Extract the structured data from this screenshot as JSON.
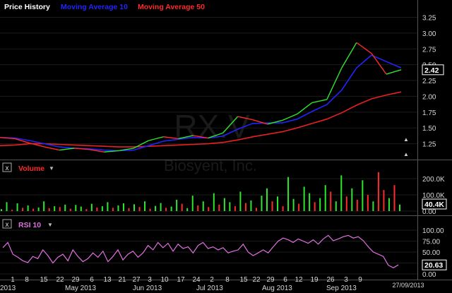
{
  "chart_data": [
    {
      "panel": "price",
      "type": "line",
      "legend": [
        {
          "name": "Price History",
          "color": "#ffffff"
        },
        {
          "name": "Moving Average 10",
          "color": "#2323ff"
        },
        {
          "name": "Moving Average 50",
          "color": "#ff2a2a"
        }
      ],
      "watermark": {
        "ticker": "RX.V",
        "company": "Biosyent, Inc."
      },
      "ylim": [
        1.0,
        3.3
      ],
      "yticks": [
        "3.25",
        "3.00",
        "2.75",
        "2.50",
        "2.25",
        "2.00",
        "1.75",
        "1.50",
        "1.25"
      ],
      "last_value": "2.42",
      "x_weeks": [
        "2013-03-28",
        "2013-04-01",
        "2013-04-08",
        "2013-04-15",
        "2013-04-22",
        "2013-04-29",
        "2013-05-06",
        "2013-05-13",
        "2013-05-20",
        "2013-05-27",
        "2013-06-03",
        "2013-06-10",
        "2013-06-17",
        "2013-06-24",
        "2013-07-01",
        "2013-07-08",
        "2013-07-15",
        "2013-07-22",
        "2013-07-29",
        "2013-08-06",
        "2013-08-12",
        "2013-08-19",
        "2013-08-26",
        "2013-09-03",
        "2013-09-09",
        "2013-09-16",
        "2013-09-23",
        "2013-09-27"
      ],
      "series": [
        {
          "name": "Price History",
          "color_up": "#2ee62e",
          "color_down": "#ff2a2a",
          "values": [
            1.35,
            1.33,
            1.26,
            1.2,
            1.15,
            1.18,
            1.16,
            1.12,
            1.14,
            1.18,
            1.3,
            1.36,
            1.33,
            1.38,
            1.34,
            1.42,
            1.68,
            1.63,
            1.56,
            1.62,
            1.72,
            1.9,
            1.95,
            2.45,
            2.85,
            2.68,
            2.35,
            2.42
          ]
        },
        {
          "name": "Moving Average 10",
          "color": "#2323ff",
          "values": [
            1.35,
            1.34,
            1.3,
            1.25,
            1.2,
            1.18,
            1.17,
            1.15,
            1.14,
            1.15,
            1.22,
            1.29,
            1.32,
            1.35,
            1.34,
            1.37,
            1.48,
            1.57,
            1.58,
            1.58,
            1.64,
            1.76,
            1.87,
            2.1,
            2.45,
            2.65,
            2.55,
            2.45
          ]
        },
        {
          "name": "Moving Average 50",
          "color": "#e82020",
          "values": [
            1.22,
            1.23,
            1.25,
            1.25,
            1.24,
            1.23,
            1.22,
            1.21,
            1.2,
            1.2,
            1.21,
            1.22,
            1.23,
            1.24,
            1.25,
            1.27,
            1.31,
            1.36,
            1.4,
            1.44,
            1.5,
            1.57,
            1.64,
            1.74,
            1.86,
            1.96,
            2.02,
            2.07
          ]
        }
      ]
    },
    {
      "panel": "volume",
      "type": "bar",
      "title": "Volume",
      "ylim": [
        0,
        300000
      ],
      "yticks": [
        "200.0K",
        "100.0K",
        "0.00"
      ],
      "last_value": "40.4K",
      "colors": {
        "up": "#2ee62e",
        "down": "#ff2a2a"
      },
      "values": [
        12000,
        55000,
        8000,
        48000,
        20000,
        35000,
        15000,
        22000,
        60000,
        18000,
        30000,
        25000,
        40000,
        15000,
        38000,
        28000,
        12000,
        45000,
        22000,
        30000,
        55000,
        20000,
        35000,
        48000,
        18000,
        42000,
        25000,
        60000,
        15000,
        32000,
        50000,
        20000,
        28000,
        70000,
        45000,
        18000,
        95000,
        35000,
        60000,
        25000,
        110000,
        40000,
        80000,
        55000,
        30000,
        120000,
        50000,
        65000,
        20000,
        95000,
        140000,
        60000,
        90000,
        30000,
        210000,
        75000,
        45000,
        150000,
        110000,
        55000,
        80000,
        160000,
        120000,
        60000,
        220000,
        90000,
        140000,
        70000,
        190000,
        100000,
        60000,
        240000,
        130000,
        80000,
        160000,
        40400
      ],
      "directions": [
        "g",
        "g",
        "r",
        "g",
        "r",
        "g",
        "r",
        "g",
        "g",
        "r",
        "g",
        "r",
        "g",
        "r",
        "g",
        "g",
        "r",
        "g",
        "r",
        "g",
        "g",
        "r",
        "g",
        "g",
        "r",
        "g",
        "r",
        "g",
        "r",
        "g",
        "g",
        "r",
        "g",
        "g",
        "r",
        "g",
        "g",
        "r",
        "g",
        "r",
        "g",
        "r",
        "g",
        "g",
        "r",
        "g",
        "r",
        "g",
        "r",
        "g",
        "g",
        "r",
        "g",
        "r",
        "g",
        "g",
        "r",
        "g",
        "g",
        "r",
        "g",
        "g",
        "r",
        "g",
        "g",
        "r",
        "g",
        "r",
        "g",
        "r",
        "g",
        "r",
        "r",
        "g",
        "r",
        "g"
      ]
    },
    {
      "panel": "rsi",
      "type": "line",
      "title": "RSI 10",
      "color": "#e070e0",
      "ylim": [
        0,
        100
      ],
      "yticks": [
        "100.00",
        "75.00",
        "50.00",
        "25.00",
        "0.00"
      ],
      "last_value": "20.63",
      "values": [
        60,
        72,
        45,
        38,
        30,
        26,
        40,
        35,
        55,
        42,
        25,
        38,
        45,
        30,
        55,
        40,
        28,
        35,
        48,
        38,
        52,
        28,
        40,
        55,
        32,
        45,
        52,
        38,
        48,
        65,
        55,
        72,
        60,
        70,
        52,
        68,
        58,
        62,
        48,
        65,
        72,
        58,
        62,
        55,
        60,
        48,
        52,
        55,
        68,
        50,
        42,
        48,
        55,
        48,
        62,
        75,
        82,
        78,
        72,
        80,
        75,
        70,
        78,
        68,
        80,
        88,
        76,
        80,
        85,
        88,
        82,
        85,
        76,
        62,
        50,
        45,
        40,
        20,
        14,
        20.63
      ]
    }
  ],
  "x_axis_labels": [
    "1",
    "8",
    "15",
    "22",
    "29",
    "6",
    "13",
    "21",
    "27",
    "3",
    "10",
    "17",
    "24",
    "2",
    "8",
    "15",
    "22",
    "29",
    "6",
    "12",
    "19",
    "26",
    "3",
    "9"
  ],
  "month_labels": [
    "2013",
    "May 2013",
    "Jun 2013",
    "Jul 2013",
    "Aug 2013",
    "Sep 2013"
  ],
  "date_label": "27/09/2013",
  "pane_controls": {
    "close_symbol": "x",
    "menu_symbol": "▼"
  }
}
